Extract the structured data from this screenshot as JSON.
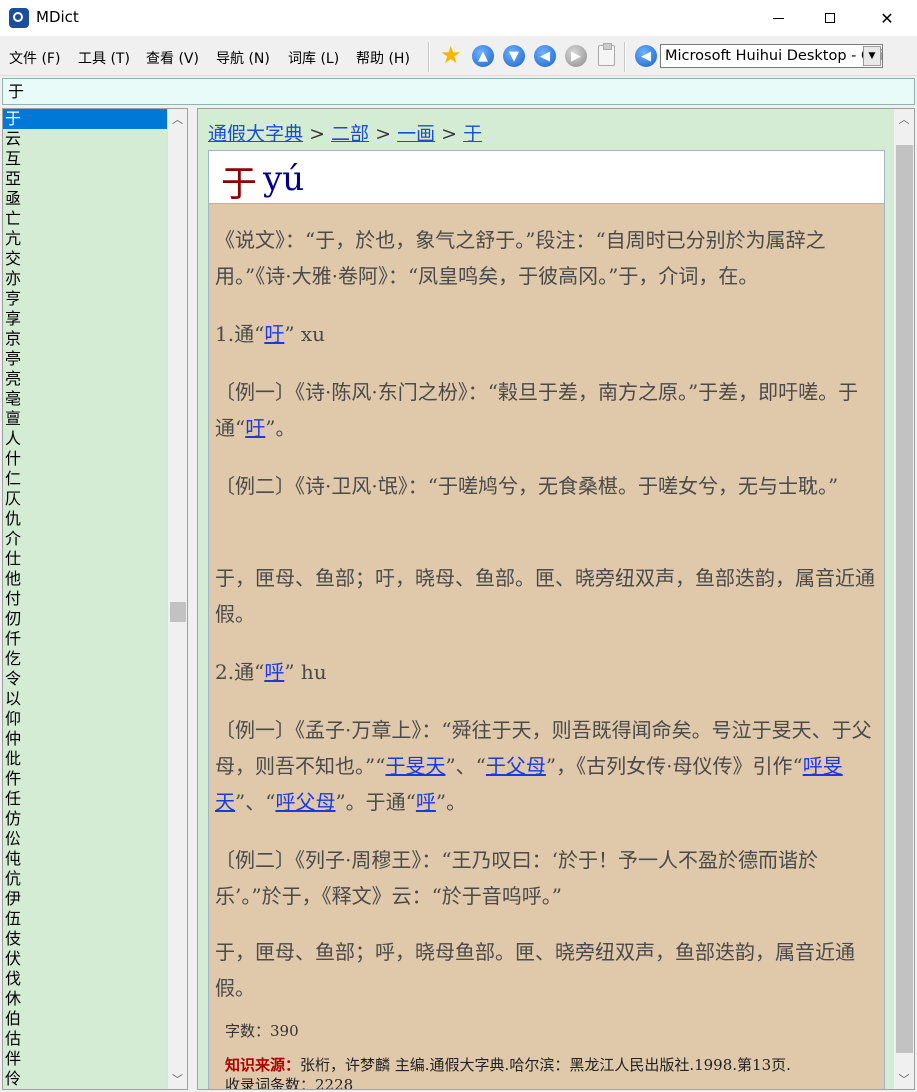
{
  "window": {
    "title": "MDict"
  },
  "menu": {
    "file": "文件 (F)",
    "tools": "工具 (T)",
    "view": "查看 (V)",
    "navigate": "导航 (N)",
    "library": "词库 (L)",
    "help": "帮助 (H)"
  },
  "toolbar": {
    "dictionary_selected": "Microsoft Huihui Desktop - Chinese (Simplified)"
  },
  "search": {
    "value": "于"
  },
  "wordlist": {
    "items": [
      "于",
      "云",
      "互",
      "亞",
      "亟",
      "亡",
      "亢",
      "交",
      "亦",
      "亨",
      "享",
      "京",
      "亭",
      "亮",
      "亳",
      "亶",
      "人",
      "什",
      "仁",
      "仄",
      "仇",
      "介",
      "仕",
      "他",
      "付",
      "仞",
      "仟",
      "仡",
      "令",
      "以",
      "仰",
      "仲",
      "仳",
      "仵",
      "任",
      "仿",
      "伀",
      "伅",
      "伉",
      "伊",
      "伍",
      "伎",
      "伏",
      "伐",
      "休",
      "伯",
      "估",
      "伴",
      "伶"
    ],
    "selected_index": 0
  },
  "entry": {
    "breadcrumb": {
      "dict": "通假大字典",
      "sep": ">",
      "radical": "二部",
      "stroke": "一画",
      "word": "于"
    },
    "headword": "于",
    "pinyin": "yú",
    "paragraphs": [
      {
        "parts": [
          "《说文》：“于，於也，象气之舒于。”段注：“自周时已分别於为属辞之用。”《诗·大雅·卷阿》：“凤皇鸣矣，于彼高冈。”于，介词，在。"
        ]
      },
      {
        "parts": [
          "1.通“",
          {
            "link": "吁"
          },
          "” xu"
        ]
      },
      {
        "parts": [
          "〔例一〕《诗·陈风·东门之枌》：“榖旦于差，南方之原。”于差，即吁嗟。于通“",
          {
            "link": "吁"
          },
          "”。"
        ]
      },
      {
        "parts": [
          "〔例二〕《诗·卫风·氓》：“于嗟鸠兮，无食桑椹。于嗟女兮，无与士耽。”"
        ]
      },
      {
        "parts": [
          "于，匣母、鱼部；吁，晓母、鱼部。匣、晓旁纽双声，鱼部迭韵，属音近通假。"
        ]
      },
      {
        "parts": [
          "2.通“",
          {
            "link": "呼"
          },
          "” hu"
        ]
      },
      {
        "parts": [
          "〔例一〕《孟子·万章上》：“舜往于天，则吾既得闻命矣。号泣于旻天、于父母，则吾不知也。”“",
          {
            "link": "于旻天"
          },
          "”、“",
          {
            "link": "于父母"
          },
          "”，《古列女传·母仪传》引作“",
          {
            "link": "呼旻天"
          },
          "”、“",
          {
            "link": "呼父母"
          },
          "”。于通“",
          {
            "link": "呼"
          },
          "”。"
        ]
      },
      {
        "parts": [
          "〔例二〕《列子·周穆王》：“王乃叹曰：‘於于！予一人不盈於德而谐於乐’。”於于，《释文》云：“於于音呜呼。”"
        ]
      },
      {
        "parts": [
          "于，匣母、鱼部；呼，晓母鱼部。匣、晓旁纽双声，鱼部迭韵，属音近通假。"
        ]
      }
    ],
    "word_count": "字数：390",
    "source_label": "知识来源：",
    "source_text": "张桁，许梦麟 主编.通假大字典.哈尔滨：黑龙江人民出版社.1998.第13页.",
    "entry_count": "收录词条数：2228"
  }
}
